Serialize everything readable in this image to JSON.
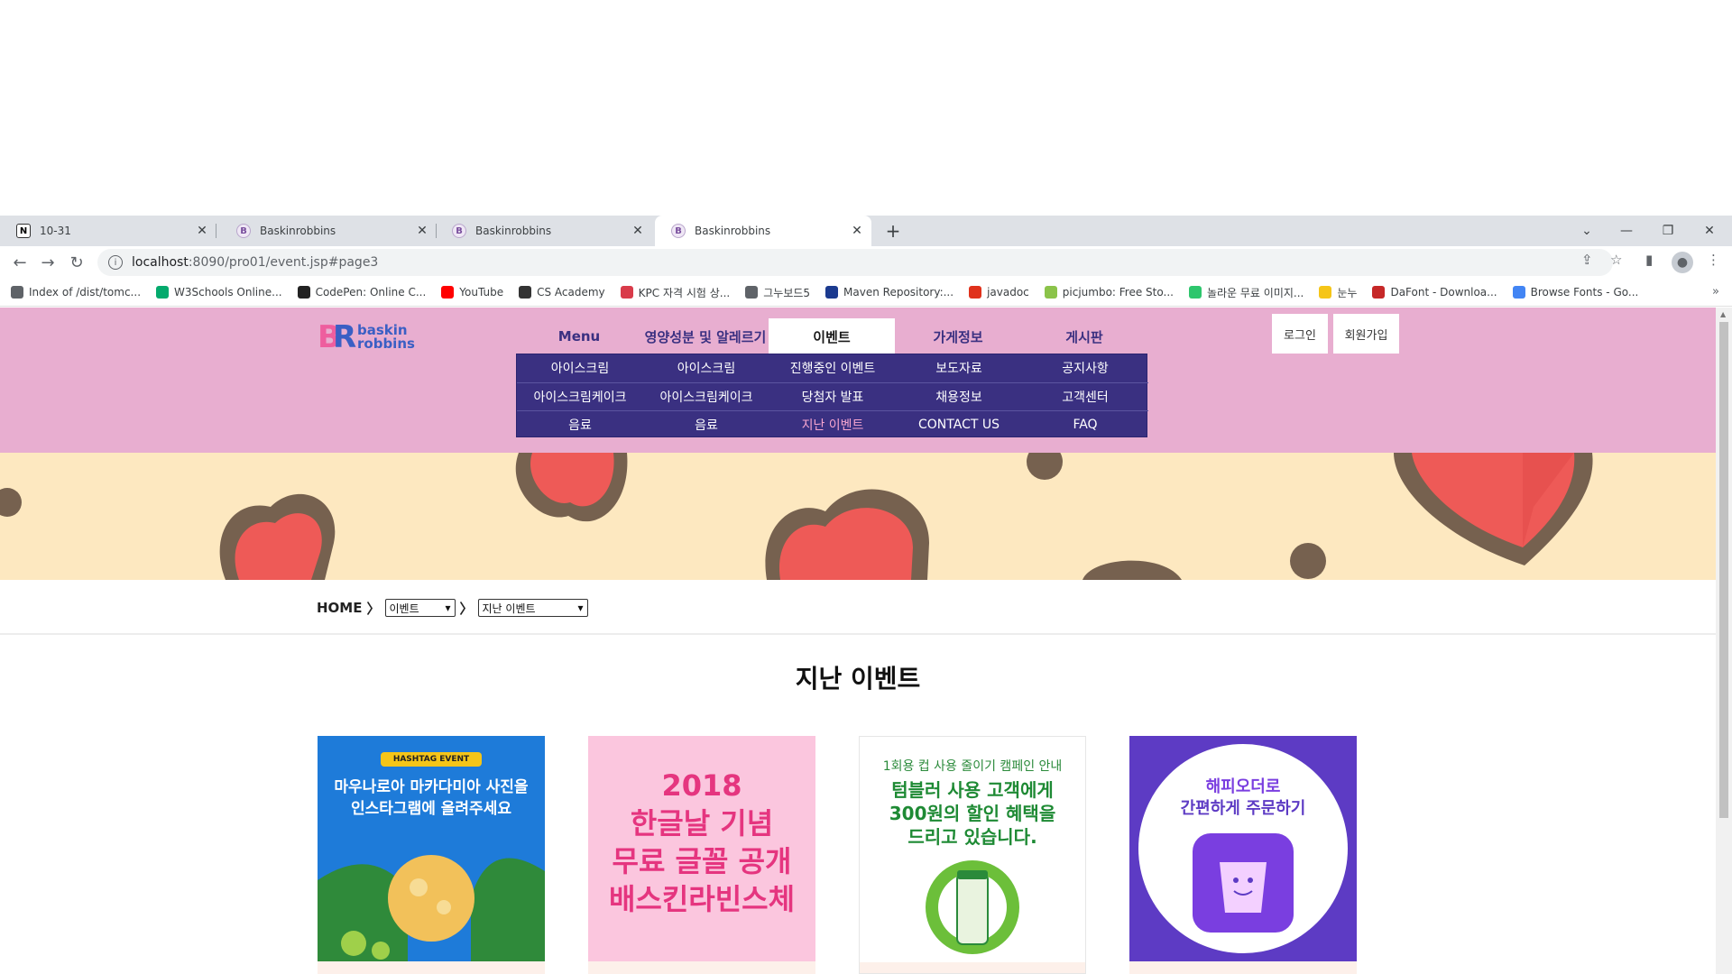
{
  "browser": {
    "tabs": [
      {
        "title": "10-31",
        "favicon": "notion-icon",
        "active": false
      },
      {
        "title": "Baskinrobbins",
        "favicon": "br-icon",
        "active": false
      },
      {
        "title": "Baskinrobbins",
        "favicon": "br-icon",
        "active": false
      },
      {
        "title": "Baskinrobbins",
        "favicon": "br-icon",
        "active": true
      }
    ],
    "url_host": "localhost",
    "url_path": ":8090/pro01/event.jsp#page3",
    "bookmarks": [
      {
        "label": "Index of /dist/tomc...",
        "icon": "globe-icon",
        "color": "#5f6368"
      },
      {
        "label": "W3Schools Online...",
        "icon": "w3-icon",
        "color": "#04aa6d"
      },
      {
        "label": "CodePen: Online C...",
        "icon": "codepen-icon",
        "color": "#222222"
      },
      {
        "label": "YouTube",
        "icon": "youtube-icon",
        "color": "#ff0000"
      },
      {
        "label": "CS Academy",
        "icon": "csacademy-icon",
        "color": "#333333"
      },
      {
        "label": "KPC 자격 시험 상...",
        "icon": "kpc-icon",
        "color": "#d93b4a"
      },
      {
        "label": "그누보드5",
        "icon": "globe-icon",
        "color": "#5f6368"
      },
      {
        "label": "Maven Repository:...",
        "icon": "maven-icon",
        "color": "#1b3a8f"
      },
      {
        "label": "javadoc",
        "icon": "javadoc-icon",
        "color": "#e0311b"
      },
      {
        "label": "picjumbo: Free Sto...",
        "icon": "picjumbo-icon",
        "color": "#8bc34a"
      },
      {
        "label": "놀라운 무료 이미지...",
        "icon": "pixabay-icon",
        "color": "#2ec66d"
      },
      {
        "label": "눈누",
        "icon": "noonnu-icon",
        "color": "#f5c518"
      },
      {
        "label": "DaFont - Downloa...",
        "icon": "dafont-icon",
        "color": "#c62828"
      },
      {
        "label": "Browse Fonts - Go...",
        "icon": "googlefonts-icon",
        "color": "#4285f4"
      }
    ]
  },
  "header": {
    "gnb": [
      "Menu",
      "영양성분 및 알레르기",
      "이벤트",
      "가게정보",
      "게시판"
    ],
    "login": "로그인",
    "signup": "회원가입",
    "submenu": [
      [
        "아이스크림",
        "아이스크림",
        "진행중인 이벤트",
        "보도자료",
        "공지사항"
      ],
      [
        "아이스크림케이크",
        "아이스크림케이크",
        "당첨자 발표",
        "채용정보",
        "고객센터"
      ],
      [
        "음료",
        "음료",
        "지난 이벤트",
        "CONTACT US",
        "FAQ"
      ]
    ]
  },
  "breadcrumb": {
    "home": "HOME",
    "level1": "이벤트",
    "level2": "지난 이벤트"
  },
  "page_title": "지난 이벤트",
  "cards": [
    {
      "badge": "HASHTAG EVENT",
      "headline_1": "마우나로아 마카다미아 사진을",
      "headline_2": "인스타그램에 올려주세요",
      "bg": "#1a6fd0"
    },
    {
      "lines": [
        "2018",
        "한글날 기념",
        "무료 글꼴 공개",
        "배스킨라빈스체"
      ],
      "bg": "#fbc6de"
    },
    {
      "small": "1회용 컵 사용 줄이기 캠페인 안내",
      "lines": [
        "텀블러 사용 고객에게",
        "300원의 할인 혜택을",
        "드리고 있습니다."
      ],
      "bg": "#ffffff"
    },
    {
      "headline_1": "해피오더로",
      "headline_2": "간편하게 주문하기",
      "bg": "#5d3bc4"
    }
  ],
  "colors": {
    "header_pink": "#e8aed0",
    "nav_purple": "#3a3081",
    "banner_cream": "#fde8c0",
    "heart_red": "#ee5a57",
    "heart_brown": "#76614f"
  }
}
